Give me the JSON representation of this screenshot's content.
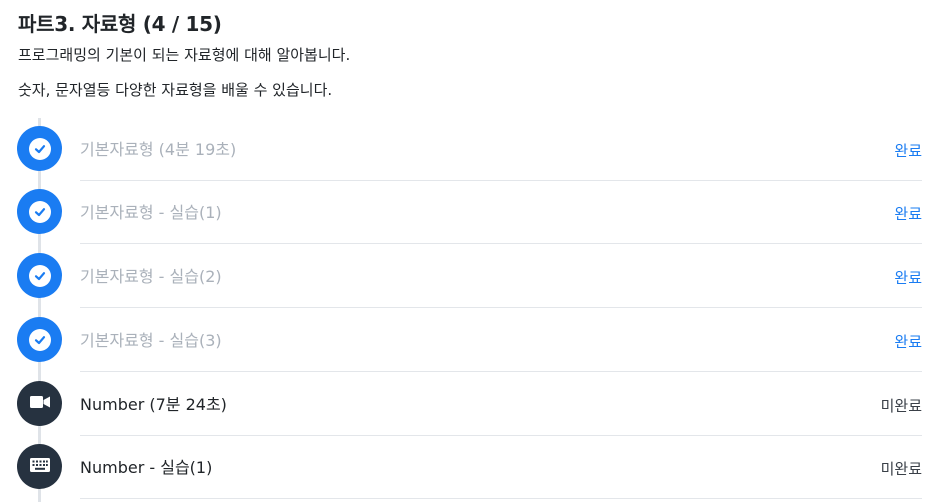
{
  "part": {
    "title": "파트3. 자료형 (4 / 15)",
    "description_1": "프로그래밍의 기본이 되는 자료형에 대해 알아봅니다.",
    "description_2": "숫자, 문자열등 다양한 자료형을 배울 수 있습니다."
  },
  "colors": {
    "accent": "#1a7cf2",
    "done_text": "#aab1ba",
    "todo_icon_bg": "#263240"
  },
  "lessons": [
    {
      "title": "기본자료형 (4분 19초)",
      "status": "완료",
      "icon": "check-icon",
      "done": true
    },
    {
      "title": "기본자료형 - 실습(1)",
      "status": "완료",
      "icon": "check-icon",
      "done": true
    },
    {
      "title": "기본자료형 - 실습(2)",
      "status": "완료",
      "icon": "check-icon",
      "done": true
    },
    {
      "title": "기본자료형 - 실습(3)",
      "status": "완료",
      "icon": "check-icon",
      "done": true
    },
    {
      "title": "Number (7분 24초)",
      "status": "미완료",
      "icon": "video-camera-icon",
      "done": false
    },
    {
      "title": "Number - 실습(1)",
      "status": "미완료",
      "icon": "keyboard-icon",
      "done": false
    }
  ]
}
